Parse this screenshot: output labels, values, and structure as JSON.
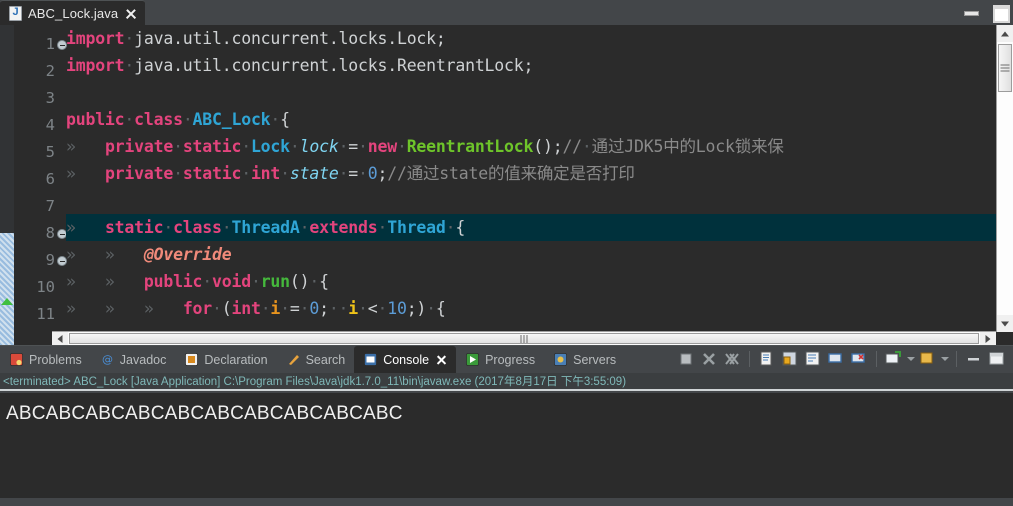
{
  "window": {
    "minimize_label": "Minimize",
    "maximize_label": "Maximize"
  },
  "editor_tab": {
    "filename": "ABC_Lock.java",
    "icon": "java-file-icon",
    "close_label": "×"
  },
  "editor": {
    "lines": [
      {
        "number": "1",
        "fold": true,
        "highlight": false,
        "tokens": [
          {
            "t": "import",
            "c": "kw"
          },
          {
            "t": "·",
            "c": "ws"
          },
          {
            "t": "java.util.concurrent.locks.Lock;",
            "c": "pl"
          }
        ]
      },
      {
        "number": "2",
        "fold": false,
        "highlight": false,
        "tokens": [
          {
            "t": "import",
            "c": "kw"
          },
          {
            "t": "·",
            "c": "ws"
          },
          {
            "t": "java.util.concurrent.locks.ReentrantLock;",
            "c": "pl"
          }
        ]
      },
      {
        "number": "3",
        "fold": false,
        "highlight": false,
        "tokens": []
      },
      {
        "number": "4",
        "fold": false,
        "highlight": false,
        "tokens": [
          {
            "t": "public",
            "c": "kw"
          },
          {
            "t": "·",
            "c": "ws"
          },
          {
            "t": "class",
            "c": "kw"
          },
          {
            "t": "·",
            "c": "ws"
          },
          {
            "t": "ABC_Lock",
            "c": "cls"
          },
          {
            "t": "·",
            "c": "ws"
          },
          {
            "t": "{",
            "c": "pl"
          }
        ]
      },
      {
        "number": "5",
        "fold": false,
        "highlight": false,
        "tokens": [
          {
            "t": "»   ",
            "c": "ws"
          },
          {
            "t": "private",
            "c": "kw"
          },
          {
            "t": "·",
            "c": "ws"
          },
          {
            "t": "static",
            "c": "kw"
          },
          {
            "t": "·",
            "c": "ws"
          },
          {
            "t": "Lock",
            "c": "typ"
          },
          {
            "t": "·",
            "c": "ws"
          },
          {
            "t": "lock",
            "c": "var"
          },
          {
            "t": "·",
            "c": "ws"
          },
          {
            "t": "=",
            "c": "pl"
          },
          {
            "t": "·",
            "c": "ws"
          },
          {
            "t": "new",
            "c": "kw"
          },
          {
            "t": "·",
            "c": "ws"
          },
          {
            "t": "ReentrantLock",
            "c": "ctor"
          },
          {
            "t": "();",
            "c": "pl"
          },
          {
            "t": "//",
            "c": "cmt"
          },
          {
            "t": "·",
            "c": "ws"
          },
          {
            "t": "通过JDK5中的Lock锁来保",
            "c": "cmt"
          }
        ]
      },
      {
        "number": "6",
        "fold": false,
        "highlight": false,
        "tokens": [
          {
            "t": "»   ",
            "c": "ws"
          },
          {
            "t": "private",
            "c": "kw"
          },
          {
            "t": "·",
            "c": "ws"
          },
          {
            "t": "static",
            "c": "kw"
          },
          {
            "t": "·",
            "c": "ws"
          },
          {
            "t": "int",
            "c": "kw"
          },
          {
            "t": "·",
            "c": "ws"
          },
          {
            "t": "state",
            "c": "var"
          },
          {
            "t": "·",
            "c": "ws"
          },
          {
            "t": "=",
            "c": "pl"
          },
          {
            "t": "·",
            "c": "ws"
          },
          {
            "t": "0",
            "c": "num"
          },
          {
            "t": ";",
            "c": "pl"
          },
          {
            "t": "//通过state的值来确定是否打印",
            "c": "cmt"
          }
        ]
      },
      {
        "number": "7",
        "fold": false,
        "highlight": false,
        "tokens": []
      },
      {
        "number": "8",
        "fold": true,
        "highlight": true,
        "tokens": [
          {
            "t": "»   ",
            "c": "ws"
          },
          {
            "t": "static",
            "c": "kw"
          },
          {
            "t": "·",
            "c": "ws"
          },
          {
            "t": "class",
            "c": "kw"
          },
          {
            "t": "·",
            "c": "ws"
          },
          {
            "t": "ThreadA",
            "c": "cls"
          },
          {
            "t": "·",
            "c": "ws"
          },
          {
            "t": "extends",
            "c": "kw"
          },
          {
            "t": "·",
            "c": "ws"
          },
          {
            "t": "Thread",
            "c": "typ"
          },
          {
            "t": "·",
            "c": "ws"
          },
          {
            "t": "{",
            "c": "pl"
          }
        ]
      },
      {
        "number": "9",
        "fold": true,
        "highlight": false,
        "tokens": [
          {
            "t": "»   »   ",
            "c": "ws"
          },
          {
            "t": "@Override",
            "c": "anno"
          }
        ]
      },
      {
        "number": "10",
        "fold": false,
        "highlight": false,
        "tokens": [
          {
            "t": "»   »   ",
            "c": "ws"
          },
          {
            "t": "public",
            "c": "kw"
          },
          {
            "t": "·",
            "c": "ws"
          },
          {
            "t": "void",
            "c": "kw"
          },
          {
            "t": "·",
            "c": "ws"
          },
          {
            "t": "run",
            "c": "meth"
          },
          {
            "t": "()",
            "c": "pl"
          },
          {
            "t": "·",
            "c": "ws"
          },
          {
            "t": "{",
            "c": "pl"
          }
        ]
      },
      {
        "number": "11",
        "fold": false,
        "highlight": false,
        "tokens": [
          {
            "t": "»   »   »   ",
            "c": "ws"
          },
          {
            "t": "for",
            "c": "kw"
          },
          {
            "t": "·",
            "c": "ws"
          },
          {
            "t": "(",
            "c": "pl"
          },
          {
            "t": "int",
            "c": "kw"
          },
          {
            "t": "·",
            "c": "ws"
          },
          {
            "t": "i",
            "c": "loopv"
          },
          {
            "t": "·",
            "c": "ws"
          },
          {
            "t": "=",
            "c": "pl"
          },
          {
            "t": "·",
            "c": "ws"
          },
          {
            "t": "0",
            "c": "num"
          },
          {
            "t": ";",
            "c": "pl"
          },
          {
            "t": "··",
            "c": "ws"
          },
          {
            "t": "i",
            "c": "loopv2"
          },
          {
            "t": "·",
            "c": "ws"
          },
          {
            "t": "<",
            "c": "pl"
          },
          {
            "t": "·",
            "c": "ws"
          },
          {
            "t": "10",
            "c": "num"
          },
          {
            "t": ";)",
            "c": "pl"
          },
          {
            "t": "·",
            "c": "ws"
          },
          {
            "t": "{",
            "c": "pl"
          }
        ]
      }
    ]
  },
  "console_panel": {
    "tabs": [
      {
        "label": "Problems",
        "icon": "problems-icon",
        "active": false,
        "closable": false
      },
      {
        "label": "Javadoc",
        "icon": "javadoc-icon",
        "active": false,
        "closable": false
      },
      {
        "label": "Declaration",
        "icon": "declaration-icon",
        "active": false,
        "closable": false
      },
      {
        "label": "Search",
        "icon": "search-icon",
        "active": false,
        "closable": false
      },
      {
        "label": "Console",
        "icon": "console-icon",
        "active": true,
        "closable": true
      },
      {
        "label": "Progress",
        "icon": "progress-icon",
        "active": false,
        "closable": false
      },
      {
        "label": "Servers",
        "icon": "servers-icon",
        "active": false,
        "closable": false
      }
    ],
    "toolbar": [
      {
        "name": "terminate-button",
        "title": "Terminate"
      },
      {
        "name": "remove-launch-button",
        "title": "Remove Launch"
      },
      {
        "name": "remove-all-terminated-button",
        "title": "Remove All Terminated Launches"
      },
      {
        "name": "clear-console-button",
        "title": "Clear Console"
      },
      {
        "name": "scroll-lock-button",
        "title": "Scroll Lock"
      },
      {
        "name": "word-wrap-button",
        "title": "Word Wrap"
      },
      {
        "name": "pin-console-button",
        "title": "Pin Console"
      },
      {
        "name": "display-selected-console-button",
        "title": "Display Selected Console"
      },
      {
        "name": "open-console-button",
        "title": "Open Console"
      },
      {
        "name": "new-console-view-button",
        "title": "New Console View"
      },
      {
        "name": "minimize-panel-button",
        "title": "Minimize"
      },
      {
        "name": "maximize-panel-button",
        "title": "Maximize"
      }
    ],
    "status_line": "<terminated> ABC_Lock [Java Application] C:\\Program Files\\Java\\jdk1.7.0_11\\bin\\javaw.exe (2017年8月17日 下午3:55:09)",
    "output": "ABCABCABCABCABCABCABCABCABCABC"
  },
  "colors": {
    "editor_background": "#2b2b2b",
    "chrome_background": "#434649",
    "current_line_highlight": "#00313c",
    "keyword": "#e3447d",
    "type": "#2fa5d5",
    "comment": "#8a8a8a",
    "string_number": "#5c9cd6",
    "status_text": "#7fb8b8"
  }
}
